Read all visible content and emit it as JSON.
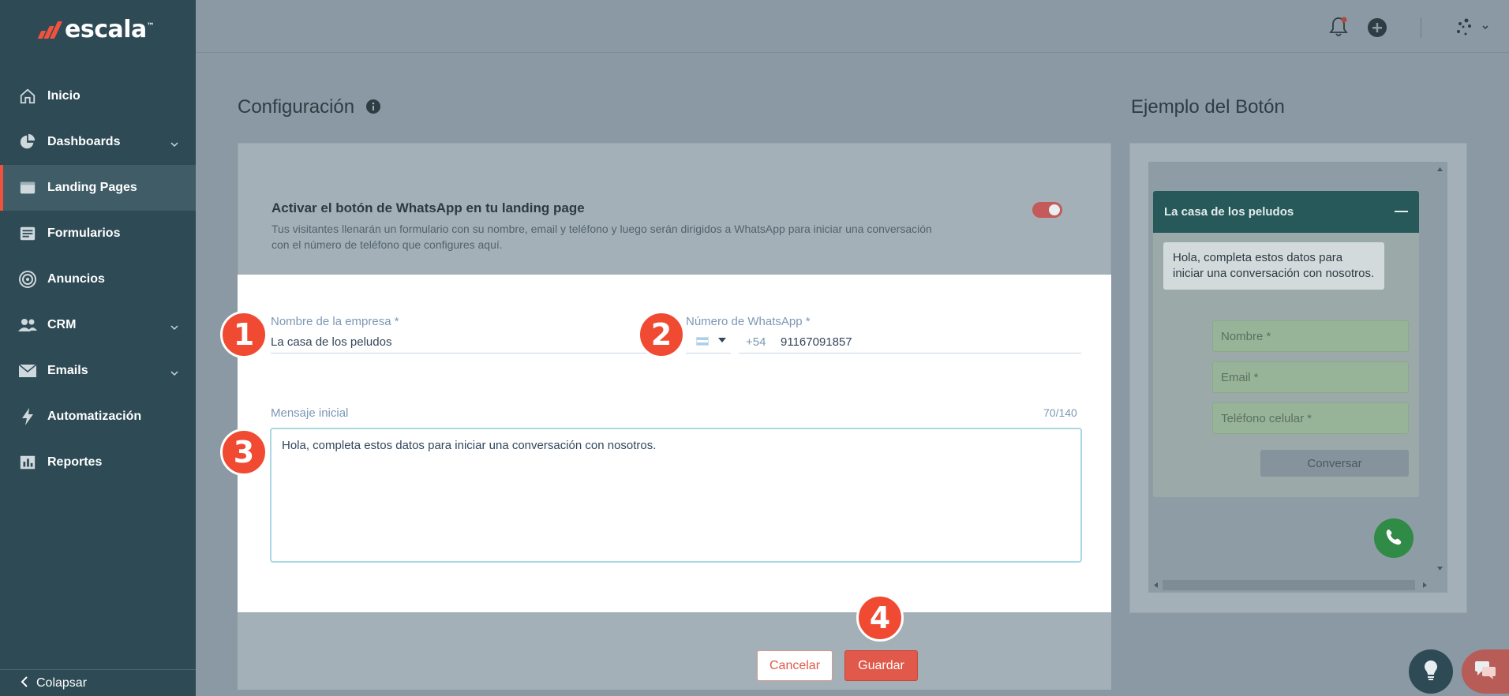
{
  "brand": {
    "name": "escala",
    "tm": "™"
  },
  "sidebar": {
    "items": [
      {
        "label": "Inicio",
        "icon": "home-icon"
      },
      {
        "label": "Dashboards",
        "icon": "pie-chart-icon",
        "expandable": true
      },
      {
        "label": "Landing Pages",
        "icon": "browser-window-icon",
        "active": true
      },
      {
        "label": "Formularios",
        "icon": "form-icon"
      },
      {
        "label": "Anuncios",
        "icon": "target-icon"
      },
      {
        "label": "CRM",
        "icon": "people-icon",
        "expandable": true
      },
      {
        "label": "Emails",
        "icon": "envelope-icon",
        "expandable": true
      },
      {
        "label": "Automatización",
        "icon": "lightning-icon"
      },
      {
        "label": "Reportes",
        "icon": "bar-report-icon"
      }
    ],
    "collapse_label": "Colapsar"
  },
  "config": {
    "title": "Configuración",
    "toggle_title": "Activar el botón de WhatsApp en tu landing page",
    "toggle_desc": "Tus visitantes llenarán un formulario con su nombre, email y teléfono y luego serán dirigidos a WhatsApp para iniciar una conversación con el número de teléfono que configures aquí.",
    "toggle_on": true,
    "company_label": "Nombre de la empresa *",
    "company_value": "La casa de los peludos",
    "whatsapp_label": "Número de WhatsApp *",
    "country_code": "+54",
    "phone_value": "91167091857",
    "message_label": "Mensaje inicial",
    "message_counter": "70/140",
    "message_value": "Hola, completa estos datos para iniciar una conversación con nosotros.",
    "cancel_label": "Cancelar",
    "save_label": "Guardar"
  },
  "steps": [
    "1",
    "2",
    "3",
    "4"
  ],
  "example": {
    "title": "Ejemplo del Botón",
    "chat_title": "La casa de los peludos",
    "bubble": "Hola, completa estos datos para iniciar una conversación con nosotros.",
    "name_placeholder": "Nombre *",
    "email_placeholder": "Email *",
    "phone_placeholder": "Teléfono celular *",
    "button_label": "Conversar"
  },
  "colors": {
    "accent": "#f0523e",
    "sidebar": "#2d4a55",
    "whatsapp": "#2f8b46"
  }
}
